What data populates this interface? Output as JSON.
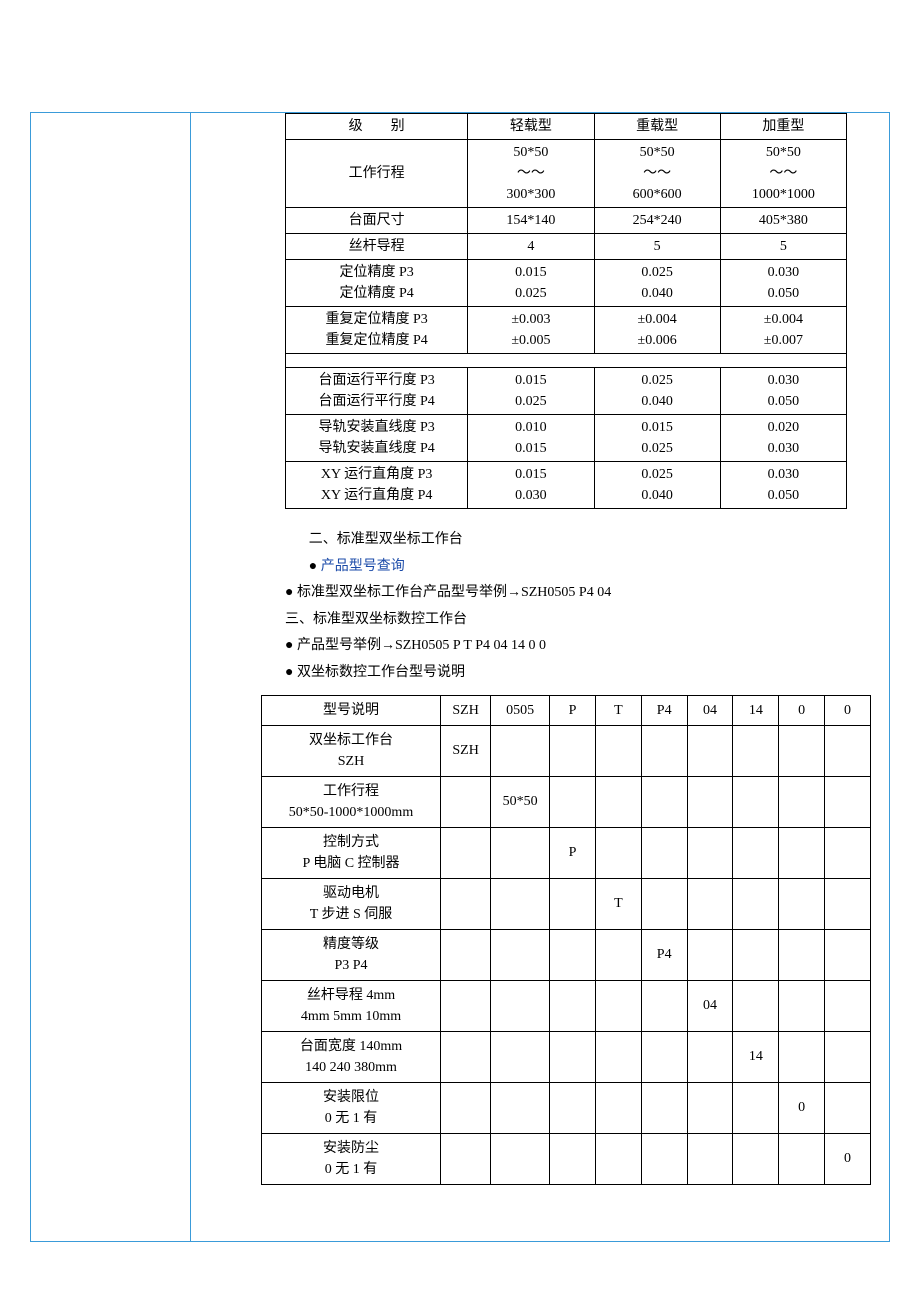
{
  "spec_table": {
    "header": [
      "级　　别",
      "轻载型",
      "重载型",
      "加重型"
    ],
    "rows": [
      [
        "工作行程",
        "50*50\n～～\n300*300",
        "50*50\n～～\n600*600",
        "50*50\n～～\n1000*1000"
      ],
      [
        "台面尺寸",
        "154*140",
        "254*240",
        "405*380"
      ],
      [
        "丝杆导程",
        "4",
        "5",
        "5"
      ],
      [
        "定位精度 P3\n定位精度 P4",
        "0.015\n0.025",
        "0.025\n0.040",
        "0.030\n0.050"
      ],
      [
        "重复定位精度 P3\n重复定位精度 P4",
        "±0.003\n±0.005",
        "±0.004\n±0.006",
        "±0.004\n±0.007"
      ],
      [
        "__gap__",
        "",
        "",
        ""
      ],
      [
        "台面运行平行度 P3\n台面运行平行度 P4",
        "0.015\n0.025",
        "0.025\n0.040",
        "0.030\n0.050"
      ],
      [
        "导轨安装直线度 P3\n导轨安装直线度 P4",
        "0.010\n0.015",
        "0.015\n0.025",
        "0.020\n0.030"
      ],
      [
        "XY 运行直角度 P3\nXY 运行直角度 P4",
        "0.015\n0.030",
        "0.025\n0.040",
        "0.030\n0.050"
      ]
    ]
  },
  "text_block": {
    "l1": "二、标准型双坐标工作台",
    "l2": "产品型号查询",
    "l3": "标准型双坐标工作台产品型号举例→SZH0505 P4 04",
    "l4": "三、标准型双坐标数控工作台",
    "l5": "产品型号举例→SZH0505 P T P4 04 14 0 0",
    "l6": "双坐标数控工作台型号说明"
  },
  "model_table": {
    "header": [
      "型号说明",
      "SZH",
      "0505",
      "P",
      "T",
      "P4",
      "04",
      "14",
      "0",
      "0"
    ],
    "rows": [
      {
        "desc": "双坐标工作台\nSZH",
        "cells": [
          "SZH",
          "",
          "",
          "",
          "",
          "",
          "",
          "",
          ""
        ]
      },
      {
        "desc": "工作行程\n50*50-1000*1000mm",
        "cells": [
          "",
          "50*50",
          "",
          "",
          "",
          "",
          "",
          "",
          ""
        ]
      },
      {
        "desc": "控制方式\nP 电脑 C 控制器",
        "cells": [
          "",
          "",
          "P",
          "",
          "",
          "",
          "",
          "",
          ""
        ]
      },
      {
        "desc": "驱动电机\nT 步进 S 伺服",
        "cells": [
          "",
          "",
          "",
          "T",
          "",
          "",
          "",
          "",
          ""
        ]
      },
      {
        "desc": "精度等级\nP3 P4",
        "cells": [
          "",
          "",
          "",
          "",
          "P4",
          "",
          "",
          "",
          ""
        ]
      },
      {
        "desc": "丝杆导程 4mm\n4mm 5mm 10mm",
        "cells": [
          "",
          "",
          "",
          "",
          "",
          "04",
          "",
          "",
          ""
        ]
      },
      {
        "desc": "台面宽度 140mm\n140 240 380mm",
        "cells": [
          "",
          "",
          "",
          "",
          "",
          "",
          "14",
          "",
          ""
        ]
      },
      {
        "desc": "安装限位\n0 无 1 有",
        "cells": [
          "",
          "",
          "",
          "",
          "",
          "",
          "",
          "0",
          ""
        ]
      },
      {
        "desc": "安装防尘\n0 无 1 有",
        "cells": [
          "",
          "",
          "",
          "",
          "",
          "",
          "",
          "",
          "0"
        ]
      }
    ]
  },
  "chart_data": [
    {
      "type": "table",
      "title": "级别规格表",
      "columns": [
        "级别",
        "轻载型",
        "重载型",
        "加重型"
      ],
      "rows": [
        [
          "工作行程",
          "50*50～～300*300",
          "50*50～～600*600",
          "50*50～～1000*1000"
        ],
        [
          "台面尺寸",
          "154*140",
          "254*240",
          "405*380"
        ],
        [
          "丝杆导程",
          "4",
          "5",
          "5"
        ],
        [
          "定位精度 P3",
          "0.015",
          "0.025",
          "0.030"
        ],
        [
          "定位精度 P4",
          "0.025",
          "0.040",
          "0.050"
        ],
        [
          "重复定位精度 P3",
          "±0.003",
          "±0.004",
          "±0.004"
        ],
        [
          "重复定位精度 P4",
          "±0.005",
          "±0.006",
          "±0.007"
        ],
        [
          "台面运行平行度 P3",
          "0.015",
          "0.025",
          "0.030"
        ],
        [
          "台面运行平行度 P4",
          "0.025",
          "0.040",
          "0.050"
        ],
        [
          "导轨安装直线度 P3",
          "0.010",
          "0.015",
          "0.020"
        ],
        [
          "导轨安装直线度 P4",
          "0.015",
          "0.025",
          "0.030"
        ],
        [
          "XY 运行直角度 P3",
          "0.015",
          "0.025",
          "0.030"
        ],
        [
          "XY 运行直角度 P4",
          "0.030",
          "0.040",
          "0.050"
        ]
      ]
    },
    {
      "type": "table",
      "title": "双坐标数控工作台型号说明",
      "columns": [
        "型号说明",
        "SZH",
        "0505",
        "P",
        "T",
        "P4",
        "04",
        "14",
        "0",
        "0"
      ],
      "rows": [
        [
          "双坐标工作台 SZH",
          "SZH",
          "",
          "",
          "",
          "",
          "",
          "",
          "",
          ""
        ],
        [
          "工作行程 50*50-1000*1000mm",
          "",
          "50*50",
          "",
          "",
          "",
          "",
          "",
          "",
          ""
        ],
        [
          "控制方式 P 电脑 C 控制器",
          "",
          "",
          "P",
          "",
          "",
          "",
          "",
          "",
          ""
        ],
        [
          "驱动电机 T 步进 S 伺服",
          "",
          "",
          "",
          "T",
          "",
          "",
          "",
          "",
          ""
        ],
        [
          "精度等级 P3 P4",
          "",
          "",
          "",
          "",
          "P4",
          "",
          "",
          "",
          ""
        ],
        [
          "丝杆导程 4mm 4mm 5mm 10mm",
          "",
          "",
          "",
          "",
          "",
          "04",
          "",
          "",
          ""
        ],
        [
          "台面宽度 140mm 140 240 380mm",
          "",
          "",
          "",
          "",
          "",
          "",
          "14",
          "",
          ""
        ],
        [
          "安装限位 0 无 1 有",
          "",
          "",
          "",
          "",
          "",
          "",
          "",
          "0",
          ""
        ],
        [
          "安装防尘 0 无 1 有",
          "",
          "",
          "",
          "",
          "",
          "",
          "",
          "",
          "0"
        ]
      ]
    }
  ]
}
